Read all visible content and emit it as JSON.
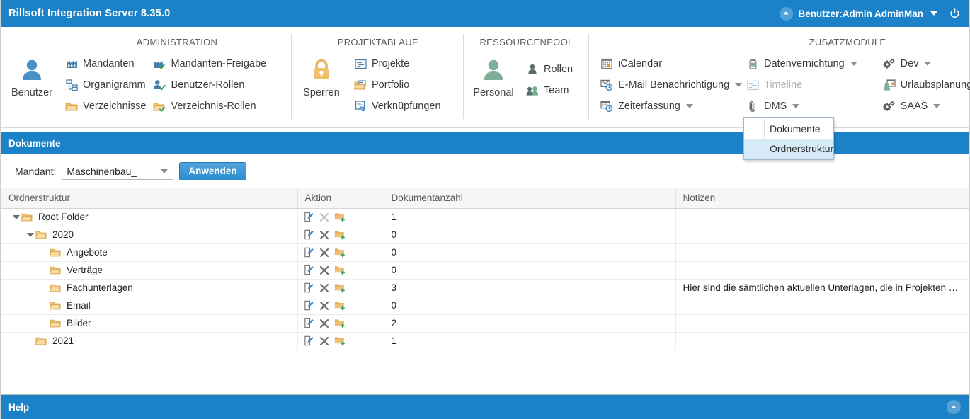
{
  "titlebar": {
    "app_title": "Rillsoft Integration Server 8.35.0",
    "user_label": "Benutzer:Admin AdminMan",
    "user_icon": "user-chevron-up-icon",
    "power_icon": "power-icon",
    "dropdown_icon": "chevron-down-icon",
    "bg_color": "#1b82c8"
  },
  "ribbon": {
    "groups": [
      {
        "title": "",
        "big": {
          "label": "Benutzer",
          "icon": "user-icon"
        },
        "columns": [
          [],
          []
        ]
      },
      {
        "title": "ADMINISTRATION",
        "columns": [
          [
            {
              "label": "Mandanten",
              "icon": "factory-icon",
              "disabled": false,
              "caret": false
            },
            {
              "label": "Organigramm",
              "icon": "org-chart-icon",
              "disabled": false,
              "caret": false
            },
            {
              "label": "Verzeichnisse",
              "icon": "folder-open-icon",
              "disabled": false,
              "caret": false
            }
          ],
          [
            {
              "label": "Mandanten-Freigabe",
              "icon": "factory-check-icon",
              "disabled": false,
              "caret": false
            },
            {
              "label": "Benutzer-Rollen",
              "icon": "user-check-icon",
              "disabled": false,
              "caret": false
            },
            {
              "label": "Verzeichnis-Rollen",
              "icon": "folder-check-icon",
              "disabled": false,
              "caret": false
            }
          ]
        ]
      },
      {
        "title": "PROJEKTABLAUF",
        "big": {
          "label": "Sperren",
          "icon": "lock-icon"
        },
        "columns": [
          [
            {
              "label": "Projekte",
              "icon": "project-icon",
              "disabled": false,
              "caret": false
            },
            {
              "label": "Portfolio",
              "icon": "portfolio-icon",
              "disabled": false,
              "caret": false
            },
            {
              "label": "Verknüpfungen",
              "icon": "link-icon",
              "disabled": false,
              "caret": false
            }
          ]
        ]
      },
      {
        "title": "RESSOURCENPOOL",
        "big": {
          "label": "Personal",
          "icon": "person-green-icon"
        },
        "columns": [
          [
            {
              "label": "Rollen",
              "icon": "role-icon",
              "disabled": false,
              "caret": false
            },
            {
              "label": "Team",
              "icon": "team-icon",
              "disabled": false,
              "caret": false
            }
          ]
        ]
      },
      {
        "title": "",
        "columns": [
          [
            {
              "label": "iCalendar",
              "icon": "calendar-icon",
              "disabled": false,
              "caret": false
            },
            {
              "label": "E-Mail Benachrichtigung",
              "icon": "mail-clock-icon",
              "disabled": false,
              "caret": true
            },
            {
              "label": "Zeiterfassung",
              "icon": "time-tracking-icon",
              "disabled": false,
              "caret": true
            }
          ]
        ]
      },
      {
        "title": "ZUSATZMODULE",
        "columns": [
          [
            {
              "label": "Datenvernichtung",
              "icon": "trash-icon",
              "disabled": false,
              "caret": true
            },
            {
              "label": "Timeline",
              "icon": "timeline-icon",
              "disabled": true,
              "caret": false
            },
            {
              "label": "DMS",
              "icon": "paperclip-icon",
              "disabled": false,
              "caret": true
            }
          ],
          [
            {
              "label": "Dev",
              "icon": "gears-icon",
              "disabled": false,
              "caret": true
            },
            {
              "label": "Urlaubsplanung",
              "icon": "vacation-icon",
              "disabled": false,
              "caret": true
            },
            {
              "label": "SAAS",
              "icon": "gears-icon",
              "disabled": false,
              "caret": true
            }
          ]
        ]
      }
    ]
  },
  "dms_menu": {
    "items": [
      {
        "label": "Dokumente",
        "selected": false
      },
      {
        "label": "Ordnerstruktur",
        "selected": true
      }
    ],
    "highlight_color": "#d7eaf7"
  },
  "page": {
    "header_title": "Dokumente"
  },
  "filter": {
    "label": "Mandant:",
    "combo_value": "Maschinenbau_",
    "apply_label": "Anwenden"
  },
  "table": {
    "headers": [
      "Ordnerstruktur",
      "Aktion",
      "Dokumentanzahl",
      "Notizen"
    ],
    "action_icons": [
      "edit-icon",
      "delete-icon",
      "add-folder-icon"
    ],
    "rows": [
      {
        "label": "Root Folder",
        "indent": 0,
        "expanded": true,
        "count": "1",
        "notes": "",
        "delete_disabled": true
      },
      {
        "label": "2020",
        "indent": 1,
        "expanded": true,
        "count": "0",
        "notes": "",
        "delete_disabled": false
      },
      {
        "label": "Angebote",
        "indent": 2,
        "expanded": null,
        "count": "0",
        "notes": "",
        "delete_disabled": false
      },
      {
        "label": "Verträge",
        "indent": 2,
        "expanded": null,
        "count": "0",
        "notes": "",
        "delete_disabled": false
      },
      {
        "label": "Fachunterlagen",
        "indent": 2,
        "expanded": null,
        "count": "3",
        "notes": "Hier sind die sämtlichen aktuellen Unterlagen, die in Projekten be…",
        "delete_disabled": false
      },
      {
        "label": "Email",
        "indent": 2,
        "expanded": null,
        "count": "0",
        "notes": "",
        "delete_disabled": false
      },
      {
        "label": "Bilder",
        "indent": 2,
        "expanded": null,
        "count": "2",
        "notes": "",
        "delete_disabled": false
      },
      {
        "label": "2021",
        "indent": 1,
        "expanded": null,
        "count": "1",
        "notes": "",
        "delete_disabled": false
      }
    ]
  },
  "footer": {
    "label": "Help",
    "scrolltop_icon": "chevron-up-icon"
  }
}
